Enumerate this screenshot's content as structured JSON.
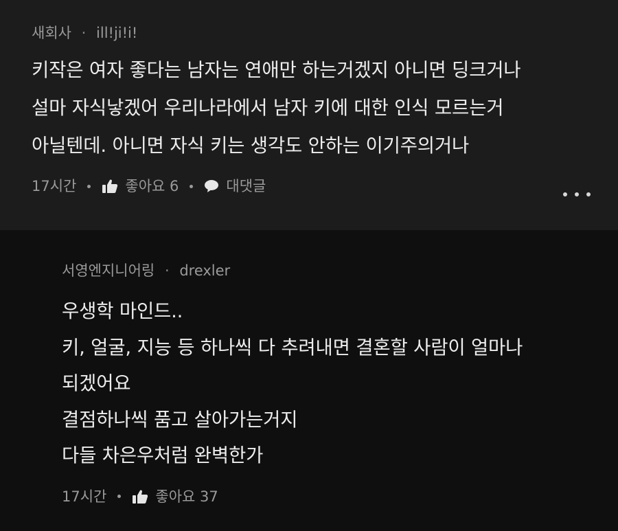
{
  "comments": [
    {
      "author": "새회사",
      "username": "ill!ji!i!",
      "separator": "·",
      "lines": [
        "키작은 여자 좋다는 남자는 연애만 하는거겠지 아니면 딩크거나",
        "설마 자식낳겠어 우리나라에서 남자 키에 대한 인식 모르는거",
        "아닐텐데. 아니면 자식 키는 생각도 안하는 이기주의거나"
      ],
      "time": "17시간",
      "like_label": "좋아요 6",
      "reply_label": "대댓글",
      "more_icon": "more-horizontal-icon"
    },
    {
      "author": "서영엔지니어링",
      "username": "drexler",
      "separator": "·",
      "lines": [
        "우생학 마인드..",
        "키, 얼굴, 지능 등 하나씩 다 추려내면 결혼할 사람이 얼마나",
        "되겠어요",
        "결점하나씩 품고 살아가는거지",
        "다들 차은우처럼 완벽한가"
      ],
      "time": "17시간",
      "like_label": "좋아요 37"
    }
  ],
  "colors": {
    "background_top": "#1c1c1c",
    "background_reply": "#0f0f0f",
    "text_primary": "#ededed",
    "text_secondary": "#9a9a9a"
  }
}
